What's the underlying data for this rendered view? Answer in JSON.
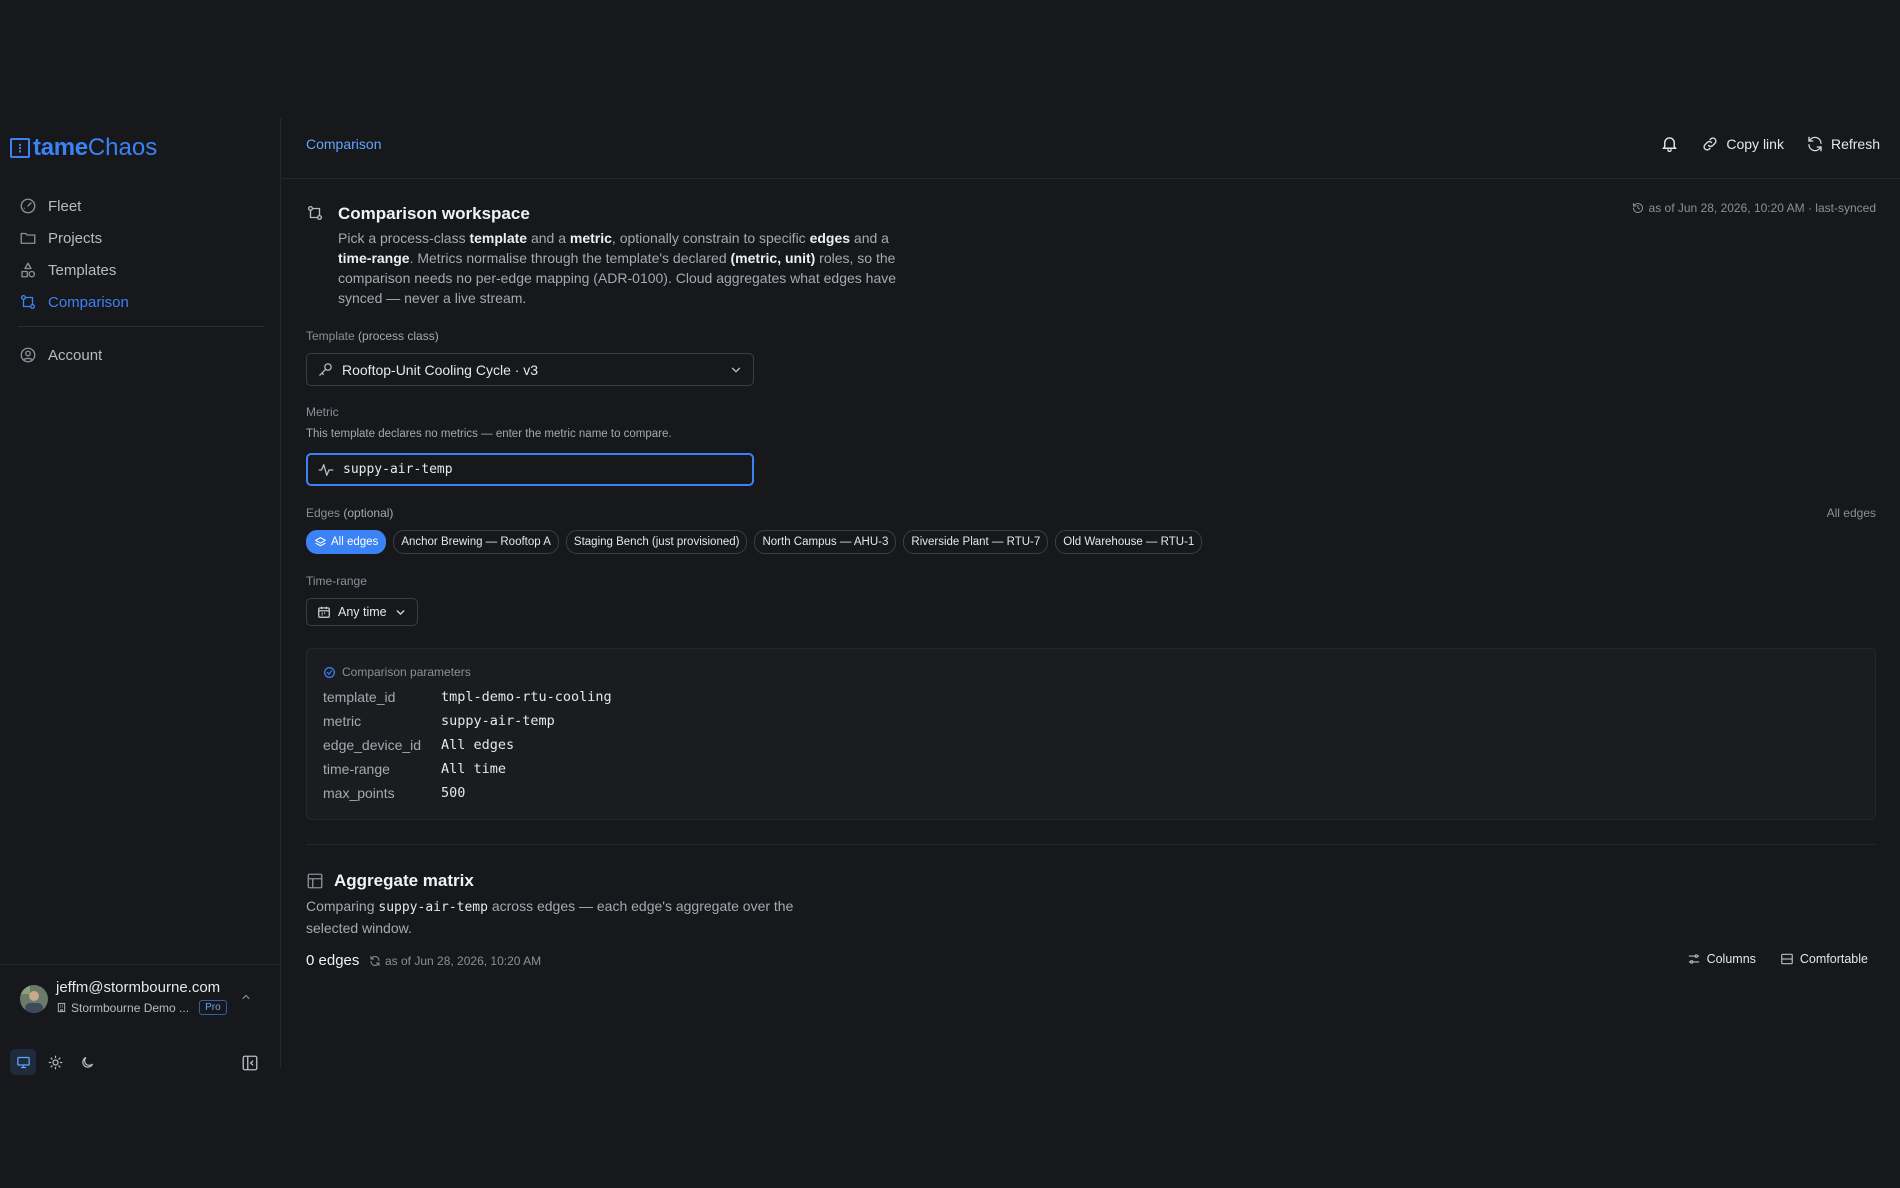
{
  "app": {
    "logo_tame": "tame",
    "logo_chaos": "Chaos",
    "logo_mark": "⋮"
  },
  "sidebar": {
    "items": [
      {
        "label": "Fleet",
        "icon": "gauge-icon"
      },
      {
        "label": "Projects",
        "icon": "folder-icon"
      },
      {
        "label": "Templates",
        "icon": "shapes-icon"
      },
      {
        "label": "Comparison",
        "icon": "git-compare-icon",
        "active": true
      },
      {
        "label": "Account",
        "icon": "user-circle-icon"
      }
    ],
    "user": {
      "email": "jeffm@stormbourne.com",
      "org": "Stormbourne Demo ...",
      "plan": "Pro"
    }
  },
  "header": {
    "breadcrumb": "Comparison",
    "actions": {
      "notifications_icon": "bell-icon",
      "copy_link": "Copy link",
      "refresh": "Refresh"
    }
  },
  "workspace": {
    "title": "Comparison workspace",
    "sync_status": "as of Jun 28, 2026, 10:20 AM · last-synced",
    "description": {
      "p1": "Pick a process-class ",
      "b1": "template",
      "p2": " and a ",
      "b2": "metric",
      "p3": ", optionally constrain to specific ",
      "b3": "edges",
      "p4": " and a ",
      "b4": "time-range",
      "p5": ". Metrics normalise through the template's declared ",
      "b5": "(metric, unit)",
      "p6": " roles, so the comparison needs no per-edge mapping (ADR-0100). Cloud aggregates what edges have synced — never a live stream."
    }
  },
  "form": {
    "template_label": "Template",
    "template_label_suffix": "(process class)",
    "template_value": "Rooftop-Unit Cooling Cycle · v3",
    "metric_label": "Metric",
    "metric_hint": "This template declares no metrics — enter the metric name to compare.",
    "metric_value": "suppy-air-temp",
    "edges_label": "Edges",
    "edges_label_suffix": "(optional)",
    "edges_summary": "All edges",
    "edges": [
      {
        "label": "All edges",
        "active": true
      },
      {
        "label": "Anchor Brewing — Rooftop A"
      },
      {
        "label": "Staging Bench (just provisioned)"
      },
      {
        "label": "North Campus — AHU-3"
      },
      {
        "label": "Riverside Plant — RTU-7"
      },
      {
        "label": "Old Warehouse — RTU-1"
      }
    ],
    "time_range_label": "Time-range",
    "time_range_value": "Any time"
  },
  "params": {
    "title": "Comparison parameters",
    "rows": [
      {
        "key": "template_id",
        "value": "tmpl-demo-rtu-cooling"
      },
      {
        "key": "metric",
        "value": "suppy-air-temp"
      },
      {
        "key": "edge_device_id",
        "value": "All edges"
      },
      {
        "key": "time-range",
        "value": "All time"
      },
      {
        "key": "max_points",
        "value": "500"
      }
    ]
  },
  "aggregate": {
    "title": "Aggregate matrix",
    "desc_pre": "Comparing ",
    "desc_metric": "suppy-air-temp",
    "desc_post": " across edges — each edge's aggregate over the selected window.",
    "count": "0 edges",
    "as_of": "as of Jun 28, 2026, 10:20 AM",
    "columns": "Columns",
    "density": "Comfortable"
  },
  "colors": {
    "accent": "#3b82f6",
    "background": "#17181b",
    "panel": "#1b1c1f"
  }
}
